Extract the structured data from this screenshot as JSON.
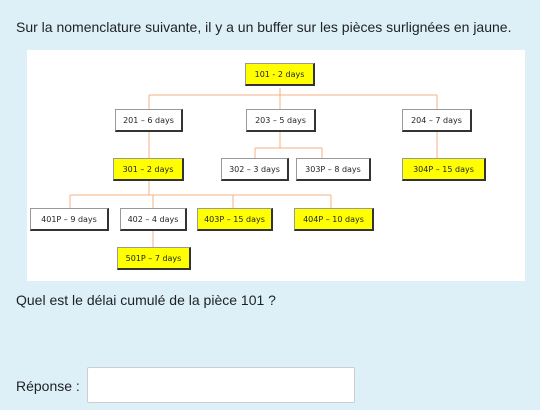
{
  "question_text": "Sur la nomenclature suivante, il y a un buffer sur les pièces surlignées en jaune.",
  "prompt_text": "Quel est le délai cumulé de la pièce 101 ?",
  "answer": {
    "label": "Réponse :",
    "value": "",
    "placeholder": ""
  },
  "colors": {
    "page_background": "#def0f7",
    "buffer_highlight": "#ffff00",
    "connector_line": "#f4b183"
  },
  "nomenclature": {
    "parts": [
      {
        "id": "101",
        "label": "101 - 2 days",
        "buffer": true
      },
      {
        "id": "201",
        "label": "201 – 6 days",
        "buffer": false
      },
      {
        "id": "203",
        "label": "203 – 5 days",
        "buffer": false
      },
      {
        "id": "204",
        "label": "204 – 7 days",
        "buffer": false
      },
      {
        "id": "301",
        "label": "301 – 2 days",
        "buffer": true
      },
      {
        "id": "302",
        "label": "302 – 3 days",
        "buffer": false
      },
      {
        "id": "303P",
        "label": "303P – 8 days",
        "buffer": false
      },
      {
        "id": "304P",
        "label": "304P – 15 days",
        "buffer": true
      },
      {
        "id": "401P",
        "label": "401P – 9 days",
        "buffer": false
      },
      {
        "id": "402",
        "label": "402 – 4 days",
        "buffer": false
      },
      {
        "id": "403P",
        "label": "403P – 15 days",
        "buffer": true
      },
      {
        "id": "404P",
        "label": "404P – 10 days",
        "buffer": true
      },
      {
        "id": "501P",
        "label": "501P – 7 days",
        "buffer": true
      }
    ]
  }
}
